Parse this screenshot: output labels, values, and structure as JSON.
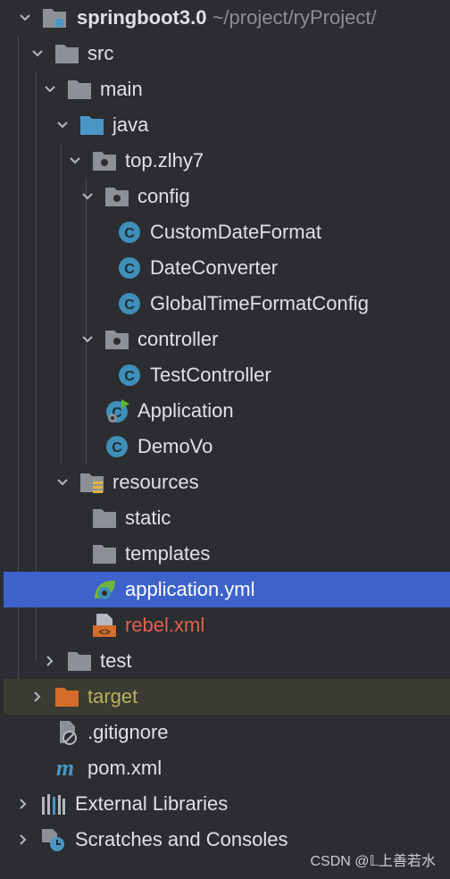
{
  "tree": {
    "project_name": "springboot3.0",
    "project_path": "~/project/ryProject/",
    "src": "src",
    "main": "main",
    "java": "java",
    "package": "top.zlhy7",
    "config": "config",
    "custom_date_format": "CustomDateFormat",
    "date_converter": "DateConverter",
    "global_time_format_config": "GlobalTimeFormatConfig",
    "controller": "controller",
    "test_controller": "TestController",
    "application": "Application",
    "demo_vo": "DemoVo",
    "resources": "resources",
    "static": "static",
    "templates": "templates",
    "application_yml": "application.yml",
    "rebel_xml": "rebel.xml",
    "test": "test",
    "target": "target",
    "gitignore": ".gitignore",
    "pom_xml": "pom.xml",
    "external_libraries": "External Libraries",
    "scratches": "Scratches and Consoles"
  },
  "watermark": "CSDN @𝕃上善若水",
  "colors": {
    "background": "#2b2d30",
    "selection": "#3d62c9",
    "excluded_row": "#3b3a33",
    "class_icon": "#3f8fb8",
    "folder": "#8d9197",
    "source_folder": "#4b95c4",
    "excluded_folder": "#d56d2a",
    "xml_red": "#e0614f",
    "target_text": "#b7b45a"
  },
  "icons": {
    "folder": "folder-icon",
    "package": "package-icon",
    "class": "class-icon",
    "spring_boot": "spring-boot-icon",
    "yaml": "yaml-icon",
    "xml": "xml-icon",
    "maven": "maven-icon",
    "ignore": "ignore-file-icon",
    "libraries": "libraries-icon",
    "scratches": "scratches-icon"
  }
}
